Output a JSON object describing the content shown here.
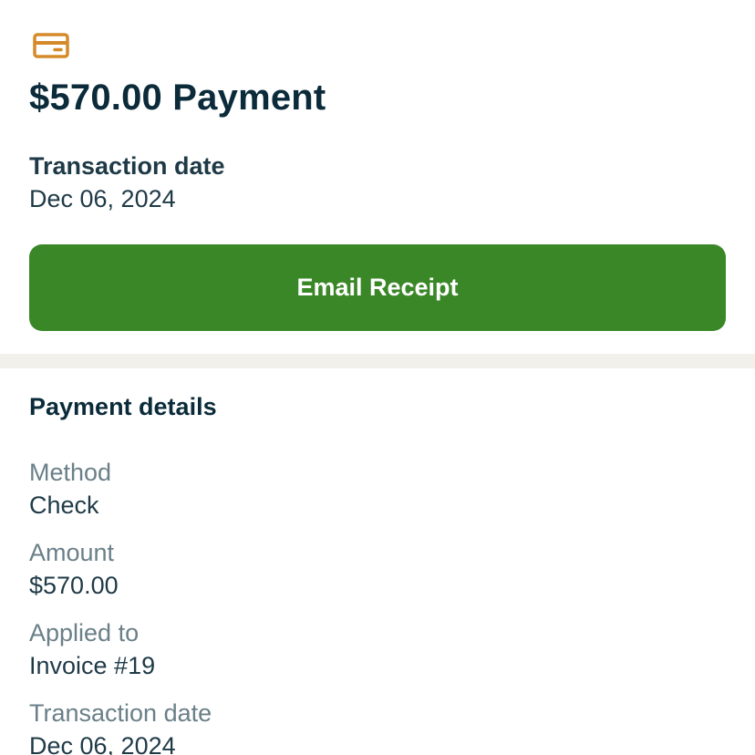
{
  "header": {
    "icon": "credit-card-icon",
    "icon_color": "#d58a2a",
    "title": "$570.00 Payment",
    "date_label": "Transaction date",
    "date_value": "Dec 06, 2024"
  },
  "actions": {
    "email_receipt_label": "Email Receipt",
    "button_color": "#3a8727"
  },
  "details": {
    "heading": "Payment details",
    "rows": [
      {
        "label": "Method",
        "value": "Check"
      },
      {
        "label": "Amount",
        "value": "$570.00"
      },
      {
        "label": "Applied to",
        "value": "Invoice #19"
      },
      {
        "label": "Transaction date",
        "value": "Dec 06, 2024"
      }
    ]
  }
}
